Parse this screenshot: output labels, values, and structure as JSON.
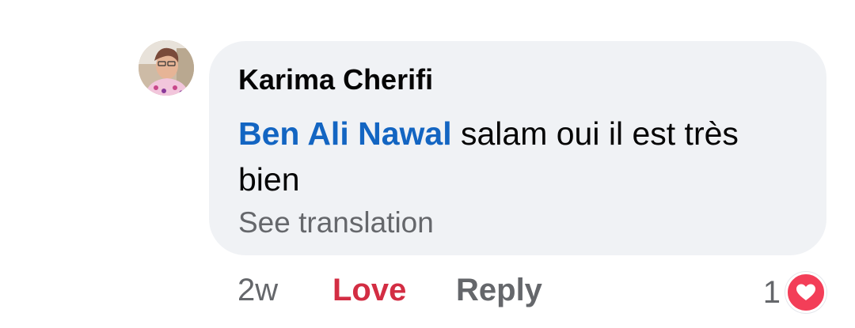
{
  "comment": {
    "author": "Karima Cherifi",
    "mention": "Ben Ali Nawal",
    "text": " salam oui il est très bien",
    "see_translation": "See translation"
  },
  "actions": {
    "time": "2w",
    "love": "Love",
    "reply": "Reply"
  },
  "reactions": {
    "count": "1",
    "icon": "heart-icon"
  },
  "colors": {
    "bubble": "#f0f2f5",
    "mention": "#1365c2",
    "love": "#d32d43",
    "heart": "#f33e58",
    "muted": "#65676b"
  }
}
